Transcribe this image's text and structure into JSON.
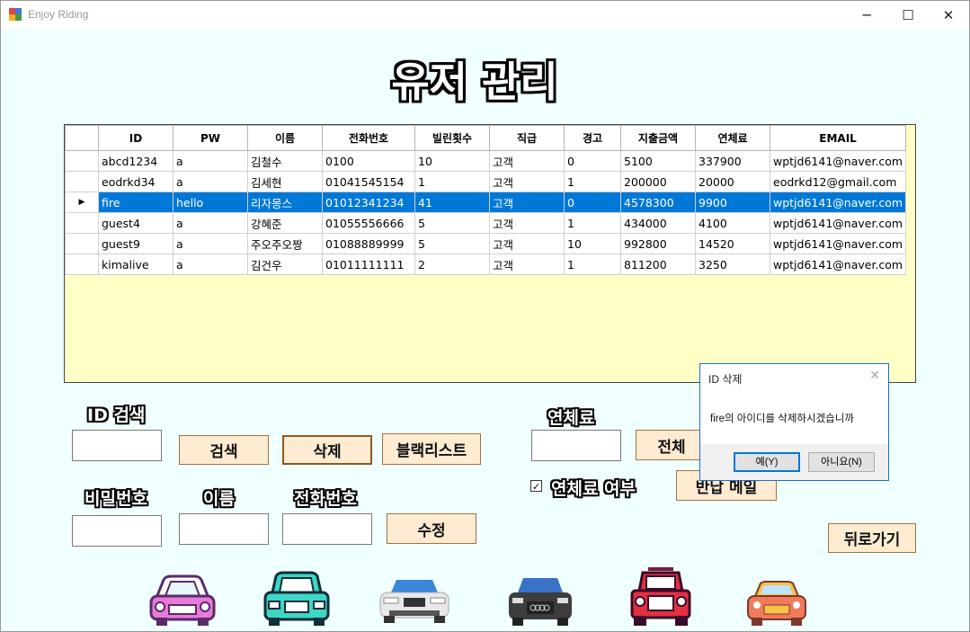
{
  "window": {
    "title": "Enjoy Riding",
    "minimize": "─",
    "maximize": "☐",
    "close": "✕"
  },
  "heading": "유저 관리",
  "table": {
    "columns": [
      "ID",
      "PW",
      "이름",
      "전화번호",
      "빌린횟수",
      "직급",
      "경고",
      "지출금액",
      "연체료",
      "EMAIL"
    ],
    "rows": [
      [
        "abcd1234",
        "a",
        "김철수",
        "0100",
        "10",
        "고객",
        "0",
        "5100",
        "337900",
        "wptjd6141@naver.com"
      ],
      [
        "eodrkd34",
        "a",
        "김세현",
        "01041545154",
        "1",
        "고객",
        "1",
        "200000",
        "20000",
        "eodrkd12@gmail.com"
      ],
      [
        "fire",
        "hello",
        "리자몽스",
        "01012341234",
        "41",
        "고객",
        "0",
        "4578300",
        "9900",
        "wptjd6141@naver.com"
      ],
      [
        "guest4",
        "a",
        "강혜준",
        "01055556666",
        "5",
        "고객",
        "1",
        "434000",
        "4100",
        "wptjd6141@naver.com"
      ],
      [
        "guest9",
        "a",
        "주오주오짱",
        "01088889999",
        "5",
        "고객",
        "10",
        "992800",
        "14520",
        "wptjd6141@naver.com"
      ],
      [
        "kimalive",
        "a",
        "김건우",
        "01011111111",
        "2",
        "고객",
        "1",
        "811200",
        "3250",
        "wptjd6141@naver.com"
      ]
    ],
    "selected_row": 2,
    "row_marker": "▶"
  },
  "labels": {
    "id_search": "ID 검색",
    "password": "비밀번호",
    "name": "이름",
    "phone": "전화번호",
    "late_fee": "연체료",
    "late_fee_check": "연체료 여부"
  },
  "buttons": {
    "search": "검색",
    "delete": "삭제",
    "blacklist": "블랙리스트",
    "edit": "수정",
    "all": "전체",
    "return_mail": "반납 메일",
    "back": "뒤로가기"
  },
  "checkbox": {
    "checked": true,
    "glyph": "✓"
  },
  "dialog": {
    "title": "ID 삭제",
    "close": "✕",
    "message": "fire의 아이디를 삭제하시겠습니까",
    "yes": "예(Y)",
    "no": "아니요(N)"
  },
  "colors": {
    "background": "#f0ffff",
    "grid_bg": "#ffffc6",
    "selection": "#0078d7",
    "button_bg": "#fdebd2"
  },
  "icons": [
    "pink-car-icon",
    "teal-car-icon",
    "silver-car-icon",
    "gray-car-icon",
    "red-jeep-icon",
    "orange-car-icon"
  ]
}
